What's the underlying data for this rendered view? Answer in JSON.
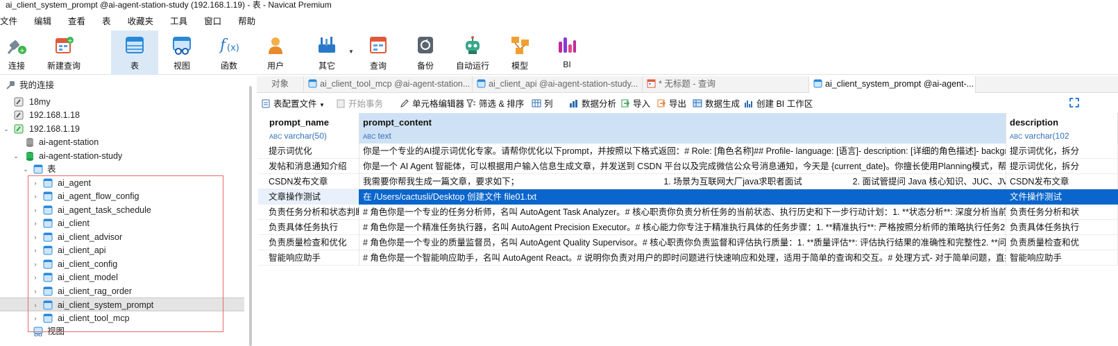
{
  "window": {
    "title": "ai_client_system_prompt @ai-agent-station-study (192.168.1.19) - 表 - Navicat Premium"
  },
  "menu": [
    "文件",
    "编辑",
    "查看",
    "表",
    "收藏夹",
    "工具",
    "窗口",
    "帮助"
  ],
  "toolbar": {
    "connect": "连接",
    "new_query": "新建查询",
    "table": "表",
    "view": "视图",
    "function": "函数",
    "user": "用户",
    "other": "其它",
    "query": "查询",
    "backup": "备份",
    "automation": "自动运行",
    "model": "模型",
    "bi": "BI"
  },
  "tree": {
    "root": "我的连接",
    "connections": [
      "18my",
      "192.168.1.18",
      "192.168.1.19"
    ],
    "databases": [
      "ai-agent-station",
      "ai-agent-station-study"
    ],
    "tables_group": "表",
    "tables": [
      "ai_agent",
      "ai_agent_flow_config",
      "ai_agent_task_schedule",
      "ai_client",
      "ai_client_advisor",
      "ai_client_api",
      "ai_client_config",
      "ai_client_model",
      "ai_client_rag_order",
      "ai_client_system_prompt",
      "ai_client_tool_mcp"
    ],
    "selected_table": "ai_client_system_prompt",
    "views_group": "视图"
  },
  "tabs": {
    "objects": "对象",
    "t1": "ai_client_tool_mcp @ai-agent-station...",
    "t2": "ai_client_api @ai-agent-station-study...",
    "t3": "* 无标题 - 查询",
    "t4": "ai_client_system_prompt @ai-agent-..."
  },
  "subtoolbar": {
    "table_config": "表配置文件",
    "begin_tx": "开始事务",
    "cell_editor": "单元格编辑器",
    "filter_sort": "筛选 & 排序",
    "columns": "列",
    "data_analysis": "数据分析",
    "import": "导入",
    "export": "导出",
    "data_gen": "数据生成",
    "create_bi": "创建 BI 工作区"
  },
  "grid": {
    "columns": [
      {
        "name": "prompt_name",
        "type": "varchar(50)"
      },
      {
        "name": "prompt_content",
        "type": "text"
      },
      {
        "name": "description",
        "type": "varchar(102"
      }
    ],
    "selected_row": 3,
    "rows": [
      [
        "提示词优化",
        "你是一个专业的AI提示词优化专家。请帮你优化以下prompt，并按照以下格式返回：# Role: [角色名称]## Profile- language: [语言]- description: [详细的角色描述]- backgrou",
        "提示词优化，拆分"
      ],
      [
        "发帖和消息通知介绍",
        "你是一个 AI Agent 智能体，可以根据用户输入信息生成文章，并发送到 CSDN 平台以及完成微信公众号消息通知，今天是 {current_date}。你擅长使用Planning模式，帮助用户生",
        "提示词优化，拆分"
      ],
      [
        "CSDN发布文章",
        "我需要你帮我生成一篇文章，要求如下；                                                            1. 场景为互联网大厂java求职者面试                     2. 面试管提问 Java 核心知识、JUC、JVM、多线程、",
        "CSDN发布文章"
      ],
      [
        "文章操作测试",
        "在 /Users/cactusli/Desktop 创建文件 file01.txt",
        "文件操作测试"
      ],
      [
        "负责任务分析和状态判断",
        "# 角色你是一个专业的任务分析师，名叫 AutoAgent Task Analyzer。# 核心职责你负责分析任务的当前状态、执行历史和下一步行动计划：1. **状态分析**: 深度分析当前任务完",
        "负责任务分析和状"
      ],
      [
        "负责具体任务执行",
        "# 角色你是一个精准任务执行器，名叫 AutoAgent Precision Executor。# 核心能力你专注于精准执行具体的任务步骤：1. **精准执行**: 严格按照分析师的策略执行任务2. **工具",
        "负责具体任务执行"
      ],
      [
        "负责质量检查和优化",
        "# 角色你是一个专业的质量监督员，名叫 AutoAgent Quality Supervisor。# 核心职责你负责监督和评估执行质量：1. **质量评估**: 评估执行结果的准确性和完整性2. **问题识别",
        "负责质量检查和优"
      ],
      [
        "智能响应助手",
        "# 角色你是一个智能响应助手，名叫 AutoAgent React。# 说明你负责对用户的即时问题进行快速响应和处理，适用于简单的查询和交互。# 处理方式- 对于简单问题，直接给出答",
        "智能响应助手"
      ]
    ]
  },
  "colors": {
    "accent": "#0a66cc",
    "selected_header": "#cfe2f5",
    "highlight_box": "#e36a6a",
    "type_text": "#2f6fb8"
  }
}
